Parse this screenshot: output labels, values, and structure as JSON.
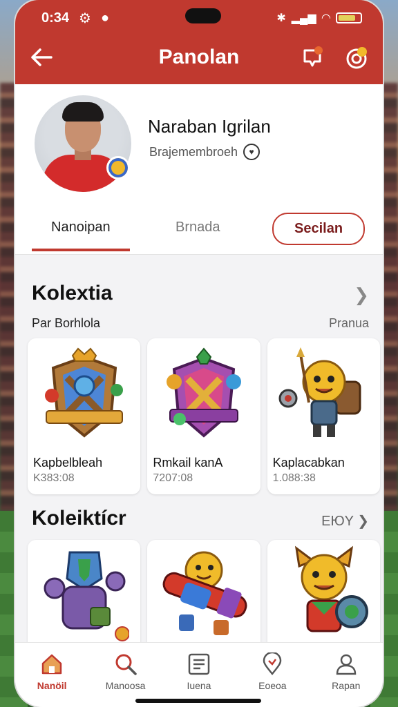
{
  "status": {
    "time": "0:34"
  },
  "header": {
    "title": "Panolan"
  },
  "profile": {
    "name": "Naraban Igrilan",
    "handle": "Brajemembroeh"
  },
  "tabs": [
    {
      "label": "Nanoipan"
    },
    {
      "label": "Brnada"
    },
    {
      "label": "Secilan"
    }
  ],
  "section1": {
    "title": "Kolextia",
    "subtitle": "Par Borhlola",
    "more": "Pranua",
    "cards": [
      {
        "name": "Kapbelbleah",
        "value": "K383:08"
      },
      {
        "name": "Rmkail kanA",
        "value": "7207:08"
      },
      {
        "name": "Kaplacabkan",
        "value": "1.088:38"
      }
    ]
  },
  "section2": {
    "title": "Koleiktícr",
    "more": "EЮY"
  },
  "nav": [
    {
      "label": "Nanöil"
    },
    {
      "label": "Manoosa"
    },
    {
      "label": "Iuena"
    },
    {
      "label": "Eoeoa"
    },
    {
      "label": "Rapan"
    }
  ],
  "colors": {
    "accent": "#c0392f"
  }
}
